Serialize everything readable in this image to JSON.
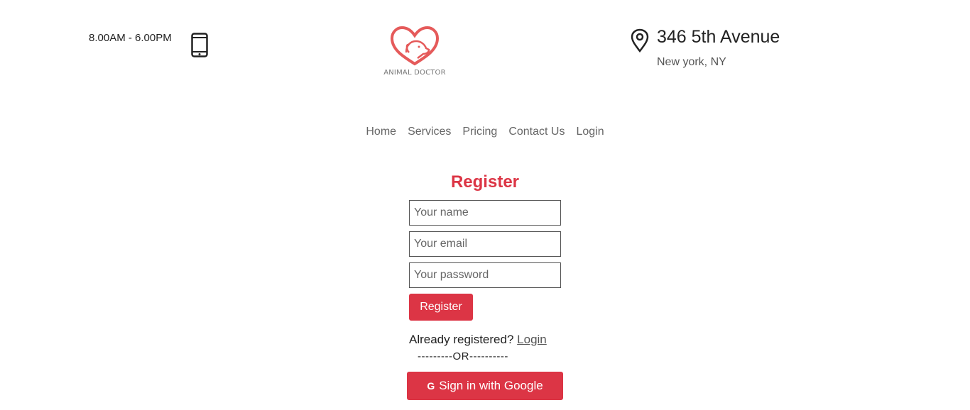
{
  "header": {
    "hours": "8.00AM - 6.00PM",
    "logo_text": "ANIMAL DOCTOR",
    "address_line1": "346 5th Avenue",
    "address_line2": "New york, NY"
  },
  "nav": {
    "items": [
      "Home",
      "Services",
      "Pricing",
      "Contact Us",
      "Login"
    ]
  },
  "form": {
    "title": "Register",
    "name_placeholder": "Your name",
    "email_placeholder": "Your email",
    "password_placeholder": "Your password",
    "submit_label": "Register",
    "already_text": "Already registered?",
    "login_link": "Login",
    "or_separator": "---------OR----------",
    "google_label": "Sign in with Google",
    "google_icon": "G"
  },
  "colors": {
    "accent": "#dc3545"
  },
  "icons": {
    "phone": "phone-icon",
    "location": "map-pin-icon",
    "logo": "heart-dog-logo",
    "google": "google-icon"
  }
}
